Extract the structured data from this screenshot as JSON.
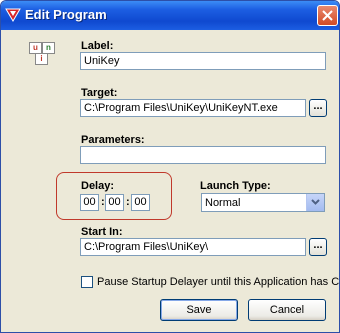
{
  "window": {
    "title": "Edit Program"
  },
  "icon": {
    "letters": [
      "u",
      "n",
      "i",
      "k"
    ],
    "colors": [
      "#c0392b",
      "#2e7d32",
      "#c0392b",
      "#1a4fa0"
    ]
  },
  "fields": {
    "label": {
      "caption": "Label:",
      "value": "UniKey"
    },
    "target": {
      "caption": "Target:",
      "value": "C:\\Program Files\\UniKey\\UniKeyNT.exe",
      "browse_label": "..."
    },
    "parameters": {
      "caption": "Parameters:",
      "value": ""
    },
    "delay": {
      "caption": "Delay:",
      "hours": "00",
      "minutes": "00",
      "seconds": "00",
      "separator": ":"
    },
    "launch_type": {
      "caption": "Launch Type:",
      "selected": "Normal"
    },
    "start_in": {
      "caption": "Start In:",
      "value": "C:\\Program Files\\UniKey\\",
      "browse_label": "..."
    }
  },
  "pause_option": {
    "label": "Pause Startup Delayer until this Application has Closed",
    "checked": false
  },
  "buttons": {
    "save": "Save",
    "cancel": "Cancel"
  },
  "colors": {
    "titlebar": "#0f49d0",
    "highlight_ring": "#c0392b",
    "dialog_bg": "#ece9d8"
  }
}
